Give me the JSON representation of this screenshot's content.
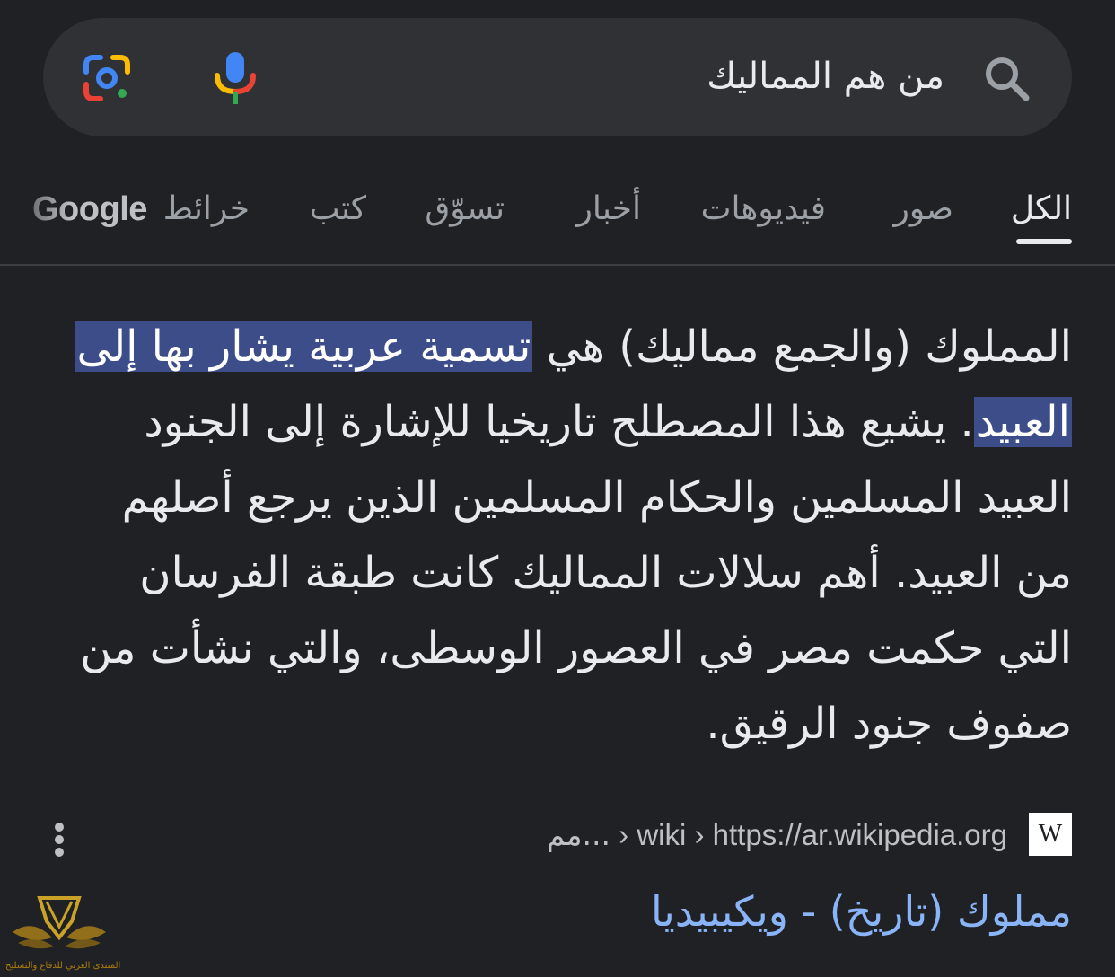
{
  "search": {
    "query": "من هم المماليك"
  },
  "tabs": {
    "all": "الكل",
    "images": "صور",
    "videos": "فيديوهات",
    "news": "أخبار",
    "shopping": "تسوّق",
    "books": "كتب",
    "maps": "خرائط",
    "maps_brand": "Google"
  },
  "snippet": {
    "part1": "المملوك (والجمع مماليك) هي ",
    "highlight1": "تسمية عربية يشار بها إلى",
    "highlight2": "العبيد",
    "part2": ". يشيع هذا المصطلح تاريخيا للإشارة إلى الجنود العبيد المسلمين والحكام المسلمين الذين يرجع أصلهم من العبيد. أهم سلالات المماليك كانت طبقة الفرسان التي حكمت مصر في العصور الوسطى، والتي نشأت من صفوف جنود الرقيق."
  },
  "result": {
    "favicon_letter": "W",
    "url_domain": "https://ar.wikipedia.org",
    "url_sep1": " › ",
    "url_path1": "wiki",
    "url_sep2": " › ",
    "url_path2": "مم...",
    "title": "مملوك (تاريخ) - ويكيبيديا"
  },
  "watermark": {
    "text": "المنتدى العربي للدفاع والتسليح"
  },
  "colors": {
    "background": "#202124",
    "search_bar": "#303134",
    "highlight": "#3c4d89",
    "link": "#8ab4f8",
    "text": "#e8eaed",
    "muted": "#9aa0a6"
  },
  "icons": {
    "search": "search-icon",
    "mic": "mic-icon",
    "lens": "google-lens-icon",
    "menu": "more-vert-icon",
    "favicon": "wikipedia-favicon-icon"
  }
}
